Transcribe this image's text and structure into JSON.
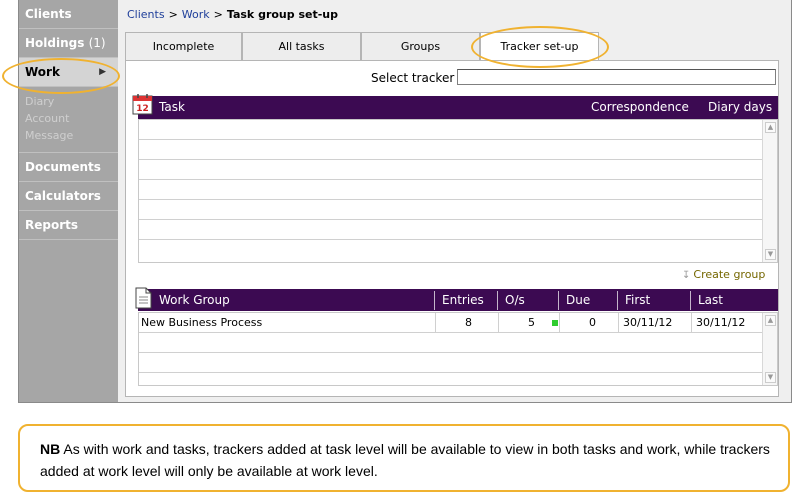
{
  "sidebar": {
    "items": [
      {
        "label": "Clients",
        "count": ""
      },
      {
        "label": "Holdings",
        "count": "(1)"
      },
      {
        "label": "Work",
        "count": ""
      },
      {
        "label": "Documents",
        "count": ""
      },
      {
        "label": "Calculators",
        "count": ""
      },
      {
        "label": "Reports",
        "count": ""
      }
    ],
    "work_sub": [
      "Diary",
      "Account",
      "Message"
    ]
  },
  "breadcrumb": {
    "items": [
      "Clients",
      "Work"
    ],
    "separator": ">",
    "current": "Task group set-up"
  },
  "tabs": [
    "Incomplete",
    "All tasks",
    "Groups",
    "Tracker set-up"
  ],
  "tracker": {
    "label": "Select tracker",
    "value": ""
  },
  "task_grid": {
    "icon": "calendar-12-icon",
    "icon_text": "12",
    "columns": [
      "Task",
      "Correspondence",
      "Diary days"
    ],
    "rows": []
  },
  "create_group": {
    "label": "Create group",
    "icon": "create-group-icon"
  },
  "group_grid": {
    "icon": "document-icon",
    "columns": [
      "Work Group",
      "Entries",
      "O/s",
      "Due",
      "First",
      "Last"
    ],
    "rows": [
      {
        "work_group": "New Business Process",
        "entries": "8",
        "os": "5",
        "status_color": "#2fcc2f",
        "due": "0",
        "first": "30/11/12",
        "last": "30/11/12"
      }
    ]
  },
  "note": {
    "lead": "NB",
    "text": " As with work and tasks, trackers added at task level will be available to view in both tasks and work, while trackers added at work level will only be available at work level."
  },
  "colors": {
    "accent": "#3c0a52",
    "highlight": "#f0b230",
    "sidebar": "#a6a6a6",
    "link": "#1f3f9a"
  }
}
